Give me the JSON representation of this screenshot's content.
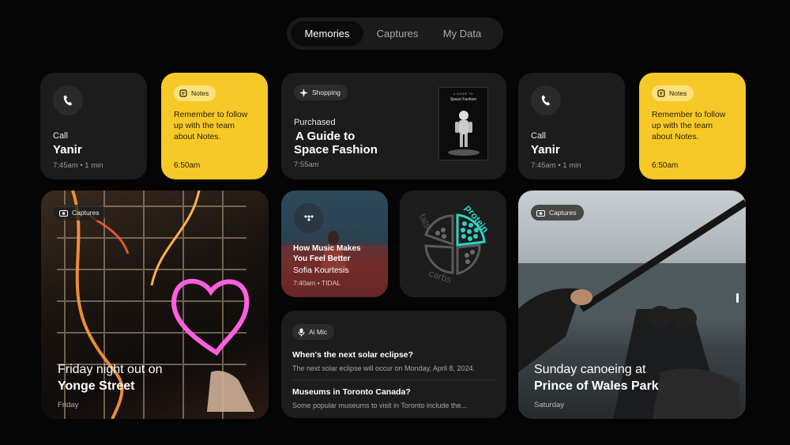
{
  "tabs": [
    "Memories",
    "Captures",
    "My Data"
  ],
  "call_cards": [
    {
      "label": "Call",
      "name": "Yanir",
      "meta": "7:45am • 1 min"
    },
    {
      "label": "Call",
      "name": "Yanir",
      "meta": "7:45am • 1 min"
    }
  ],
  "note_cards": [
    {
      "tag": "Notes",
      "text": "Remember to follow up with the team about Notes.",
      "time": "6:50am"
    },
    {
      "tag": "Notes",
      "text": "Remember to follow up with the team about Notes.",
      "time": "6:50am"
    }
  ],
  "shopping": {
    "tag": "Shopping",
    "label": "Purchased",
    "title_line1": "A Guide to",
    "title_line2": "Space Fashion",
    "time": "7:55am",
    "book_small": "A GUIDE TO",
    "book_title": "Space Fashion"
  },
  "captures_left": {
    "tag": "Captures",
    "line1": "Friday night out on",
    "line2": "Yonge Street",
    "date": "Friday"
  },
  "music": {
    "title_line1": "How Music Makes",
    "title_line2": "You Feel Better",
    "artist": "Sofia Kourtesis",
    "meta": "7:40am • TIDAL"
  },
  "nutrition": {
    "fats": "fats",
    "protein": "protein",
    "carbs": "carbs"
  },
  "ai_mic": {
    "tag": "Ai Mic",
    "items": [
      {
        "q": "When's the next solar eclipse?",
        "a": "The next solar eclipse will occur on Monday, April 8, 2024."
      },
      {
        "q": "Museums in Toronto Canada?",
        "a": "Some popular museums to visit in Toronto include the..."
      }
    ]
  },
  "captures_right": {
    "tag": "Captures",
    "line1": "Sunday canoeing at",
    "line2": "Prince of Wales Park",
    "date": "Saturday"
  },
  "colors": {
    "note_yellow": "#f7c928",
    "protein_teal": "#2ed3c2",
    "card_dark": "#1c1c1c"
  }
}
